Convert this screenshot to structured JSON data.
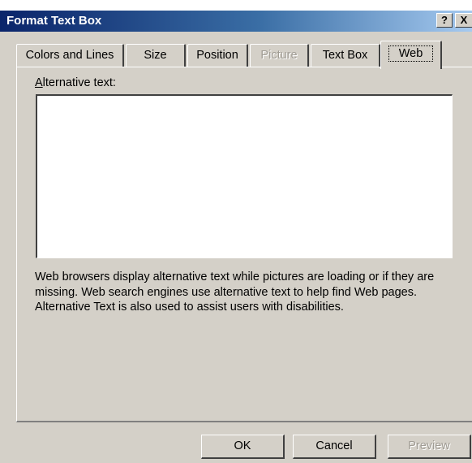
{
  "window": {
    "title": "Format Text Box",
    "help_button": "?",
    "close_button": "X"
  },
  "tabs": [
    {
      "label": "Colors and Lines",
      "state": "normal"
    },
    {
      "label": "Size",
      "state": "normal"
    },
    {
      "label": "Position",
      "state": "normal"
    },
    {
      "label": "Picture",
      "state": "disabled"
    },
    {
      "label": "Text Box",
      "state": "normal"
    },
    {
      "label": "Web",
      "state": "active"
    }
  ],
  "web_page": {
    "alt_text_label_accel": "A",
    "alt_text_label_rest": "lternative text:",
    "alt_text_value": "",
    "help_text": "Web browsers display alternative text while pictures are loading or if they are missing.  Web search engines use alternative text to help find Web pages.  Alternative Text is also used to assist users with disabilities."
  },
  "buttons": {
    "ok": "OK",
    "cancel": "Cancel",
    "preview": "Preview"
  },
  "colors": {
    "dialog_face": "#d4d0c8",
    "titlebar_start": "#0a246a",
    "titlebar_end": "#a6caf0",
    "disabled_text": "#a09c94"
  }
}
